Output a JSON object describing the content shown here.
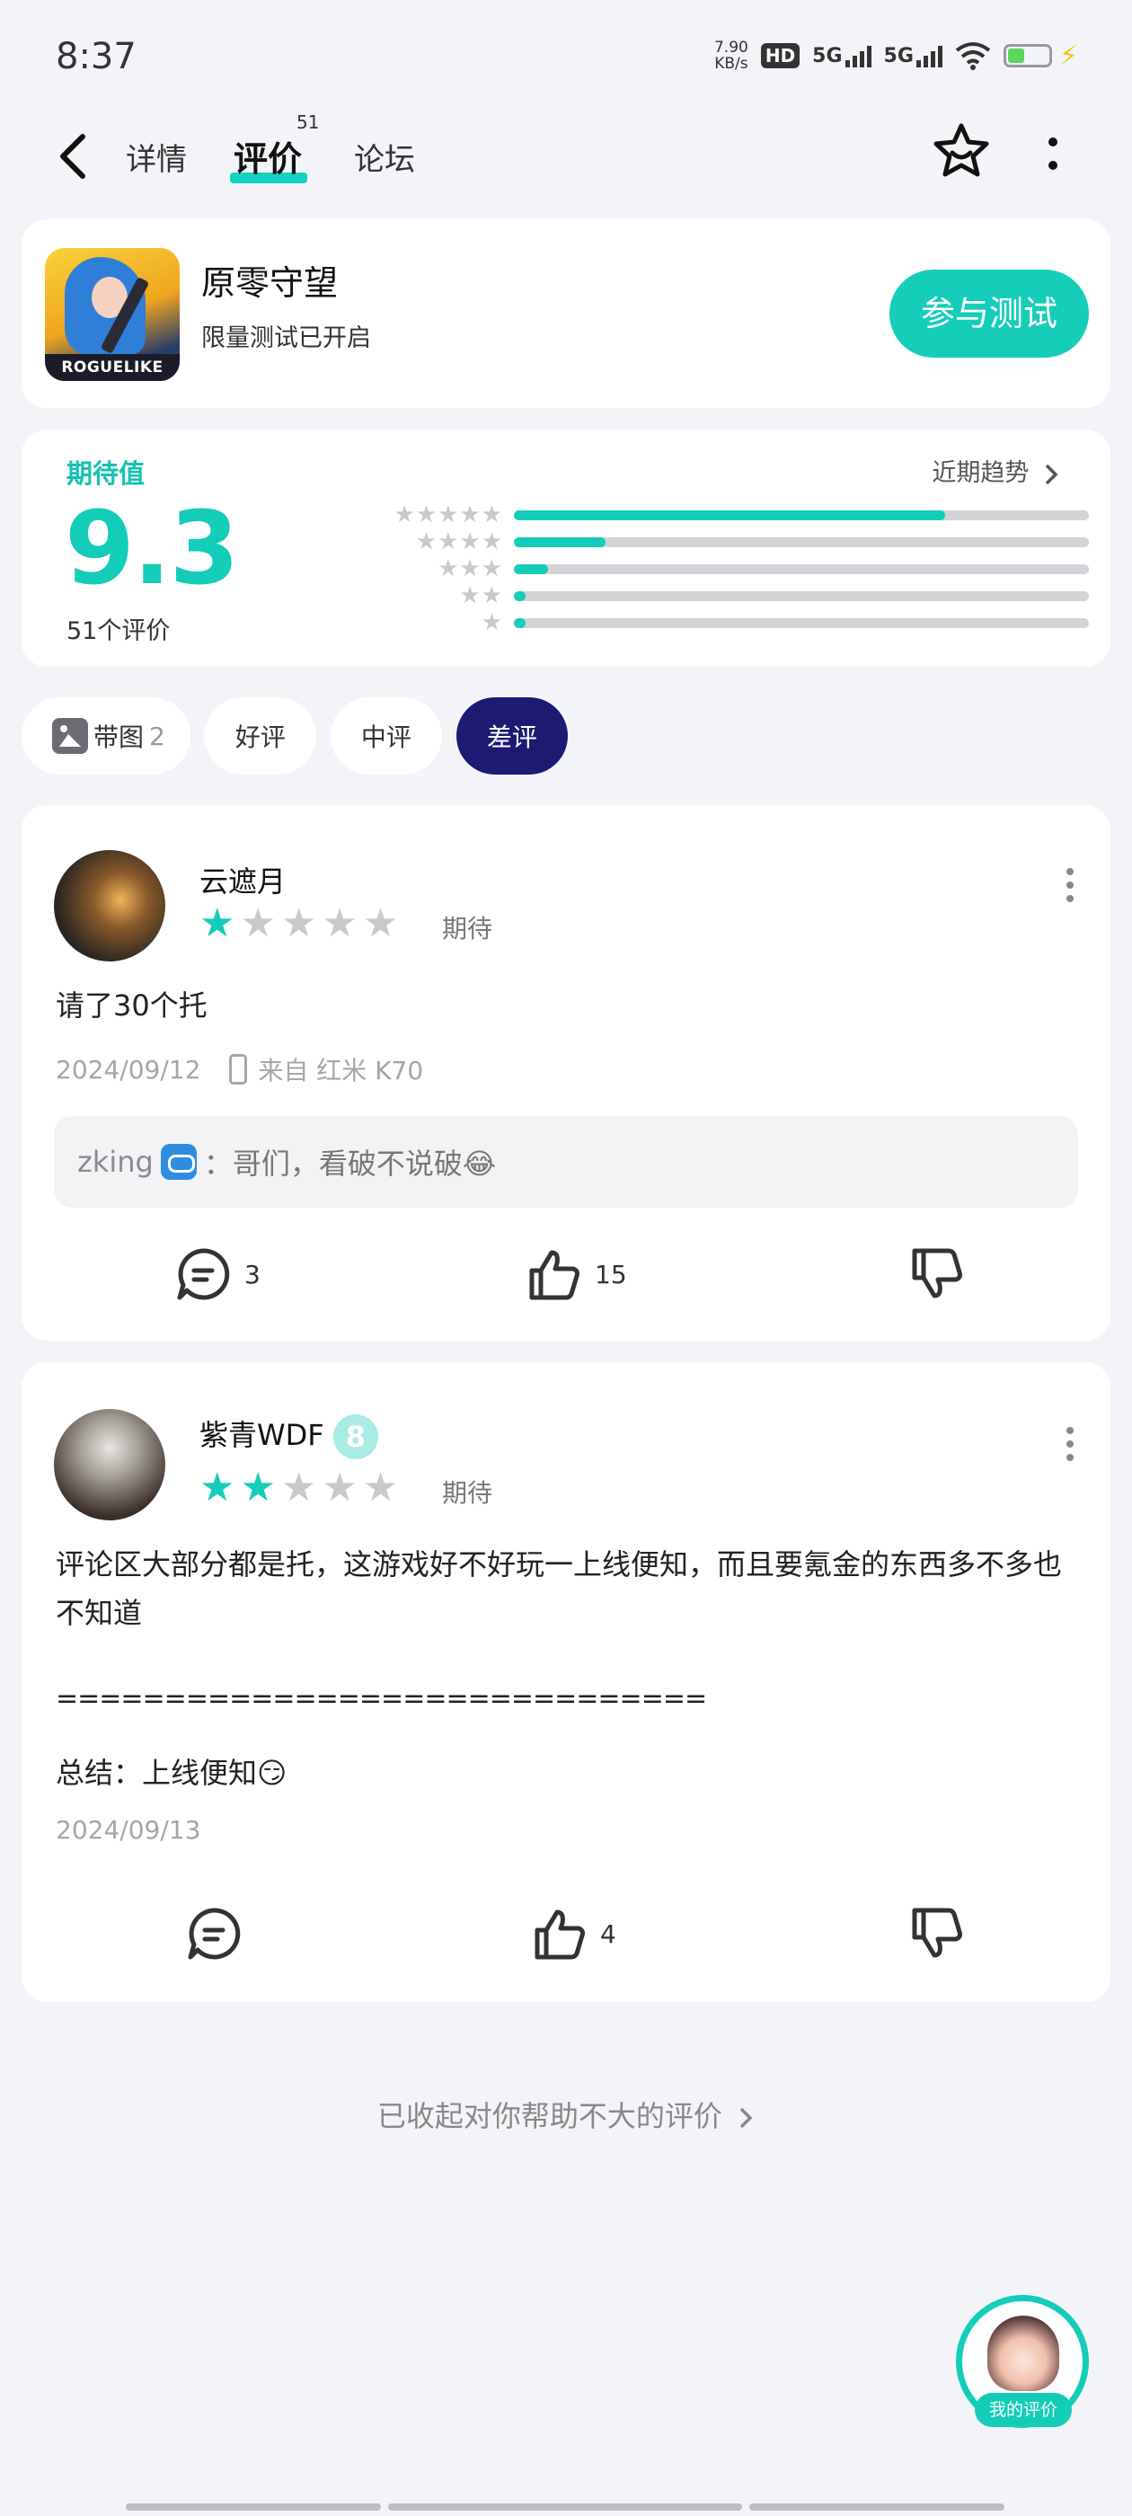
{
  "status_bar": {
    "time": "8:37",
    "speed_value": "7.90",
    "speed_unit": "KB/s",
    "hd_label": "HD",
    "sim1": "5G",
    "sim2": "5G"
  },
  "nav": {
    "tabs": [
      {
        "label": "详情"
      },
      {
        "label": "评价",
        "count": "51",
        "active": true
      },
      {
        "label": "论坛"
      }
    ]
  },
  "game": {
    "title": "原零守望",
    "subtitle": "限量测试已开启",
    "icon_banner": "ROGUELIKE",
    "join_label": "参与测试"
  },
  "rating": {
    "label": "期待值",
    "trend_label": "近期趋势",
    "score": "9.3",
    "count_label": "51个评价",
    "distribution": [
      {
        "stars": 5,
        "fraction": 0.75
      },
      {
        "stars": 4,
        "fraction": 0.16
      },
      {
        "stars": 3,
        "fraction": 0.06
      },
      {
        "stars": 2,
        "fraction": 0.02
      },
      {
        "stars": 1,
        "fraction": 0.02
      }
    ]
  },
  "filters": [
    {
      "label": "带图",
      "count": "2"
    },
    {
      "label": "好评"
    },
    {
      "label": "中评"
    },
    {
      "label": "差评",
      "active": true
    }
  ],
  "reviews": [
    {
      "user": "云遮月",
      "rating": 1,
      "tag": "期待",
      "text": "请了30个托",
      "date": "2024/09/12",
      "device": "来自 红米 K70",
      "reply_user": "zking",
      "reply_text": "：哥们，看破不说破😂",
      "comments": "3",
      "likes": "15"
    },
    {
      "user": "紫青WDF",
      "level": "8",
      "rating": 2,
      "tag": "期待",
      "text_p1": "评论区大部分都是托，这游戏好不好玩一上线便知，而且要氪金的东西多不多也不知道",
      "text_p2": "==============================",
      "text_p3": "总结：上线便知😏",
      "date": "2024/09/13",
      "likes": "4"
    }
  ],
  "collapsed_label": "已收起对你帮助不大的评价",
  "my_review_label": "我的评价",
  "colors": {
    "accent": "#14cdb8",
    "active_filter": "#1e1a72",
    "background": "#f3f4f8"
  }
}
